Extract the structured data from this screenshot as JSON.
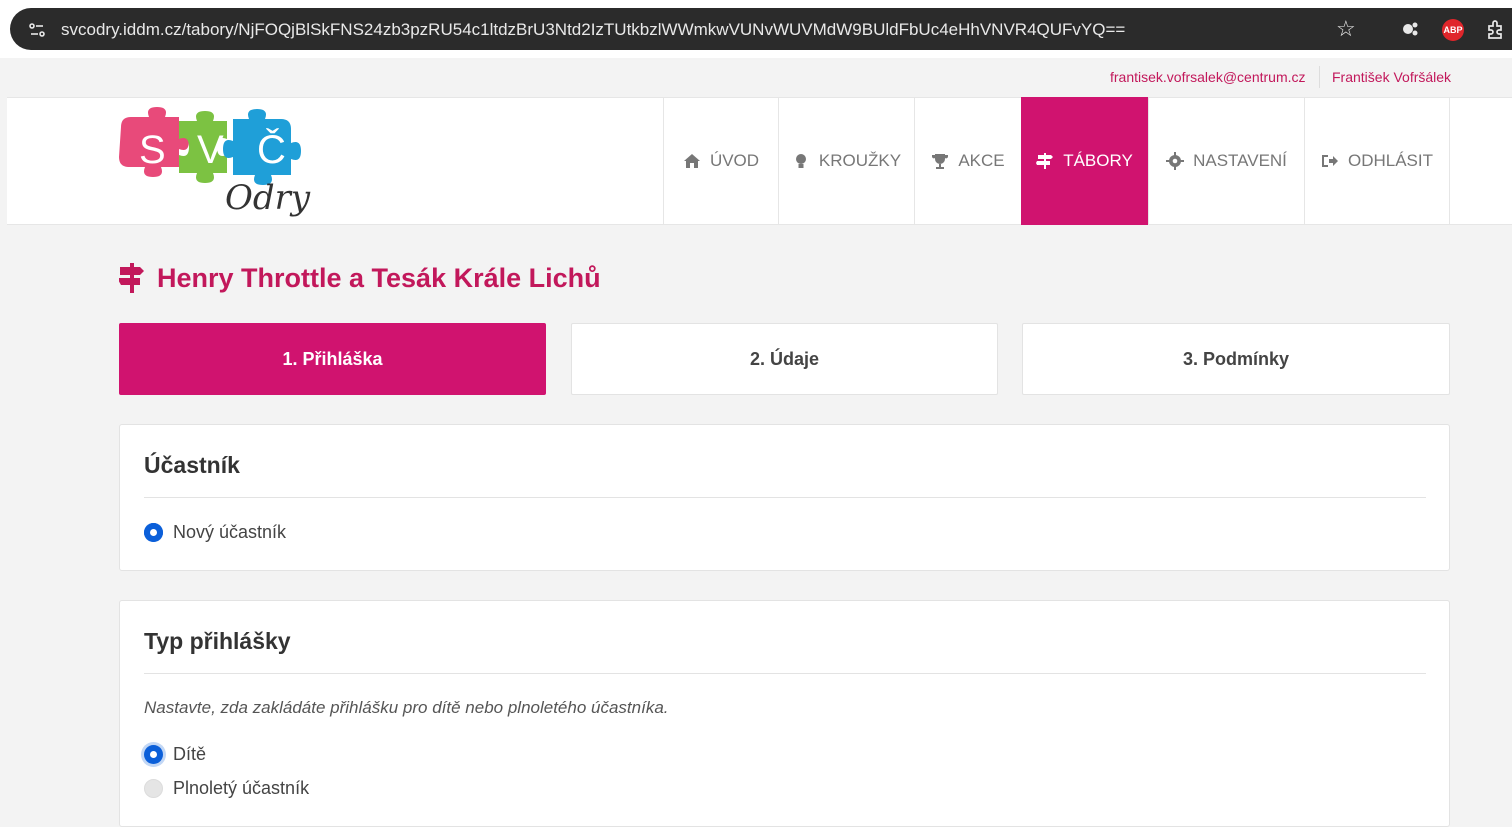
{
  "browser": {
    "url": "svcodry.iddm.cz/tabory/NjFOQjBlSkFNS24zb3pzRU54c1ltdzBrU3Ntd2IzTUtkbzlWWmkwVUNvWUVMdW9BUldFbUc4eHhVNVR4QUFvYQ==",
    "abp_label": "ABP"
  },
  "user": {
    "email": "frantisek.vofrsalek@centrum.cz",
    "name": "František Vofršálek"
  },
  "logo": {
    "letters": [
      "S",
      "V",
      "Č"
    ],
    "script": "Odry"
  },
  "nav": [
    {
      "label": "ÚVOD",
      "icon": "home-icon"
    },
    {
      "label": "KROUŽKY",
      "icon": "lightbulb-icon"
    },
    {
      "label": "AKCE",
      "icon": "trophy-icon"
    },
    {
      "label": "TÁBORY",
      "icon": "signpost-icon"
    },
    {
      "label": "NASTAVENÍ",
      "icon": "gear-icon"
    },
    {
      "label": "ODHLÁSIT",
      "icon": "sign-out-icon"
    }
  ],
  "page": {
    "title": "Henry Throttle a Tesák Krále Lichů"
  },
  "steps": [
    {
      "label": "1. Přihláška"
    },
    {
      "label": "2. Údaje"
    },
    {
      "label": "3. Podmínky"
    }
  ],
  "participant_card": {
    "title": "Účastník",
    "options": [
      {
        "label": "Nový účastník"
      }
    ]
  },
  "type_card": {
    "title": "Typ přihlášky",
    "hint": "Nastavte, zda zakládáte přihlášku pro dítě nebo plnoletého účastníka.",
    "options": [
      {
        "label": "Dítě"
      },
      {
        "label": "Plnoletý účastník"
      }
    ]
  },
  "colors": {
    "accent": "#d0136f",
    "link": "#c2185b",
    "radio": "#0b5fd9"
  }
}
